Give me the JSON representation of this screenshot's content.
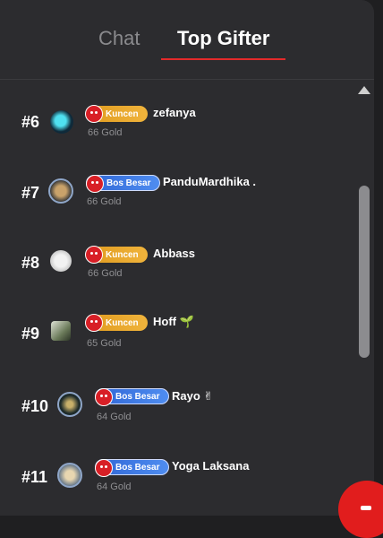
{
  "tabs": {
    "chat": "Chat",
    "top_gifter": "Top Gifter",
    "active": "Top Gifter"
  },
  "gifters": [
    {
      "rank": "#6",
      "badge": "Kuncen",
      "badge_color": "#f0a22a",
      "username": "zefanya",
      "gold": "66 Gold",
      "avatar_icon": "avatar-teal-icon"
    },
    {
      "rank": "#7",
      "badge": "Bos Besar",
      "badge_color": "#3d7be8",
      "username": "PanduMardhika .",
      "gold": "66 Gold",
      "avatar_icon": "avatar-framed-icon"
    },
    {
      "rank": "#8",
      "badge": "Kuncen",
      "badge_color": "#f0a22a",
      "username": "Abbass",
      "gold": "66 Gold",
      "avatar_icon": "avatar-white-icon"
    },
    {
      "rank": "#9",
      "badge": "Kuncen",
      "badge_color": "#f0a22a",
      "username": "Hoff 🌱",
      "gold": "65 Gold",
      "avatar_icon": "avatar-photo-icon"
    },
    {
      "rank": "#10",
      "badge": "Bos Besar",
      "badge_color": "#3d7be8",
      "username": "Rayo ✌",
      "gold": "64 Gold",
      "avatar_icon": "avatar-framed-icon"
    },
    {
      "rank": "#11",
      "badge": "Bos Besar",
      "badge_color": "#3d7be8",
      "username": "Yoga Laksana",
      "gold": "64 Gold",
      "avatar_icon": "avatar-framed-icon"
    }
  ],
  "colors": {
    "accent": "#e32a2a",
    "panel": "#2c2c2f",
    "background": "#1f1f21"
  }
}
